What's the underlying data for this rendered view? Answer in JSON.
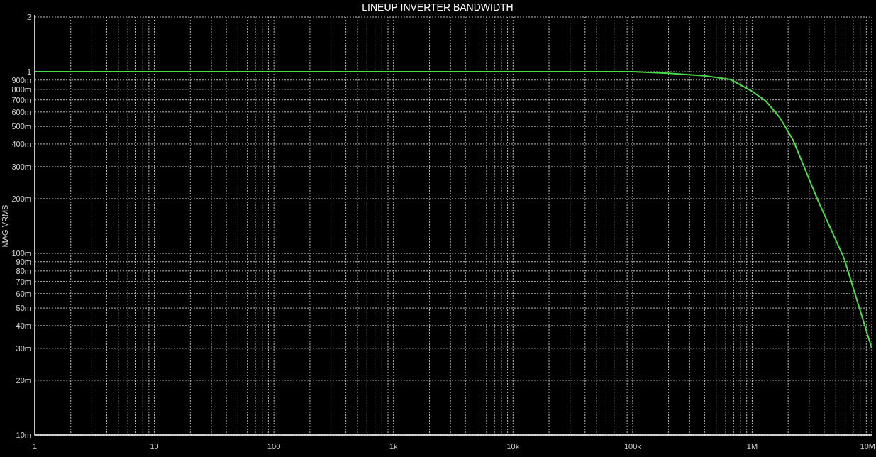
{
  "plot": {
    "title": "LINEUP INVERTER BANDWIDTH",
    "y_axis_label": "MAG VRMS",
    "x_tick_labels": [
      "1",
      "10",
      "100",
      "1k",
      "10k",
      "100k",
      "1M",
      "10M"
    ],
    "y_tick_labels": [
      "2",
      "1",
      "900m",
      "800m",
      "700m",
      "600m",
      "500m",
      "400m",
      "300m",
      "200m",
      "100m",
      "90m",
      "80m",
      "70m",
      "60m",
      "50m",
      "40m",
      "30m",
      "20m",
      "10m"
    ]
  }
}
